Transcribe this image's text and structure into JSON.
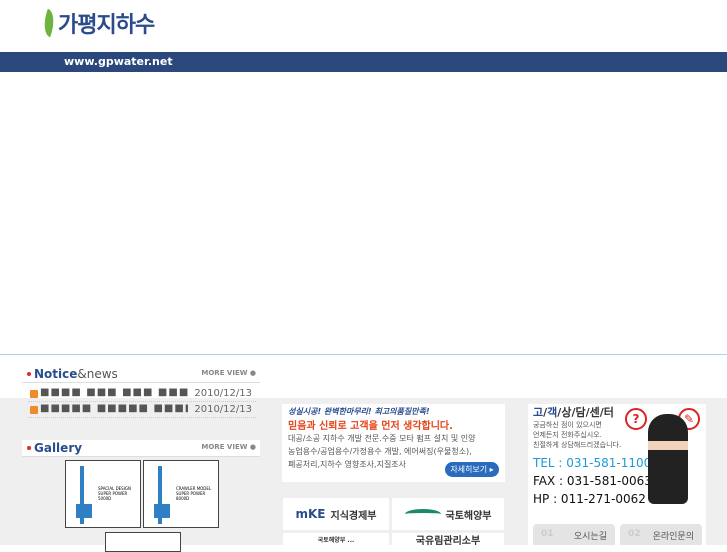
{
  "header": {
    "logo_text": "가평지하수",
    "site_url": "www.gpwater.net"
  },
  "notice": {
    "title": "Notice",
    "title_suffix": "&news",
    "more": "MORE VIEW",
    "items": [
      {
        "title": "■■■■ ■■■ ■■■ ■■■ ■■ ...",
        "date": "2010/12/13"
      },
      {
        "title": "■■■■■ ■■■■■ ■■■■■■ ...",
        "date": "2010/12/13"
      }
    ]
  },
  "gallery": {
    "title": "Gallery",
    "more": "MORE VIEW",
    "items": [
      {
        "caption": "SPACIAL DESIGN SUPER POWER 5000D"
      },
      {
        "caption": "CRAWLER MODEL SUPER POWER 8000D"
      }
    ]
  },
  "promo": {
    "slogan": "성실시공! 완벽한마무리! 최고의품질만족!",
    "headline": "믿음과 신뢰로 고객을 먼저 생각합니다.",
    "lines": [
      "대공/소공 지하수 개발 전문.수중 모타 펌프 설치 및 인양",
      "농업용수/공업용수/가정용수 개발, 에어써징(우물청소),",
      "폐공처리,지하수 영향조사,지질조사"
    ],
    "button": "자세히보기 ▸"
  },
  "orgs": [
    {
      "mark": "mKE",
      "name": "지식경제부"
    },
    {
      "name": "국토해양부"
    },
    {
      "name": "국토해양부 ..."
    },
    {
      "name": "국유림관리소부"
    }
  ],
  "customer": {
    "title_parts": [
      "고",
      "객",
      "상",
      "담",
      "센",
      "터"
    ],
    "desc": [
      "궁금하신 점이 있으시면",
      "언제든지 전화주십시오.",
      "친절하게 상담해드리겠습니다."
    ],
    "tel": "TEL : 031-581-1100",
    "fax": "FAX : 031-581-0063",
    "hp": "HP : 011-271-0062",
    "buttons": [
      {
        "num": "01",
        "label": "오시는길"
      },
      {
        "num": "02",
        "label": "온라인문의"
      }
    ]
  }
}
